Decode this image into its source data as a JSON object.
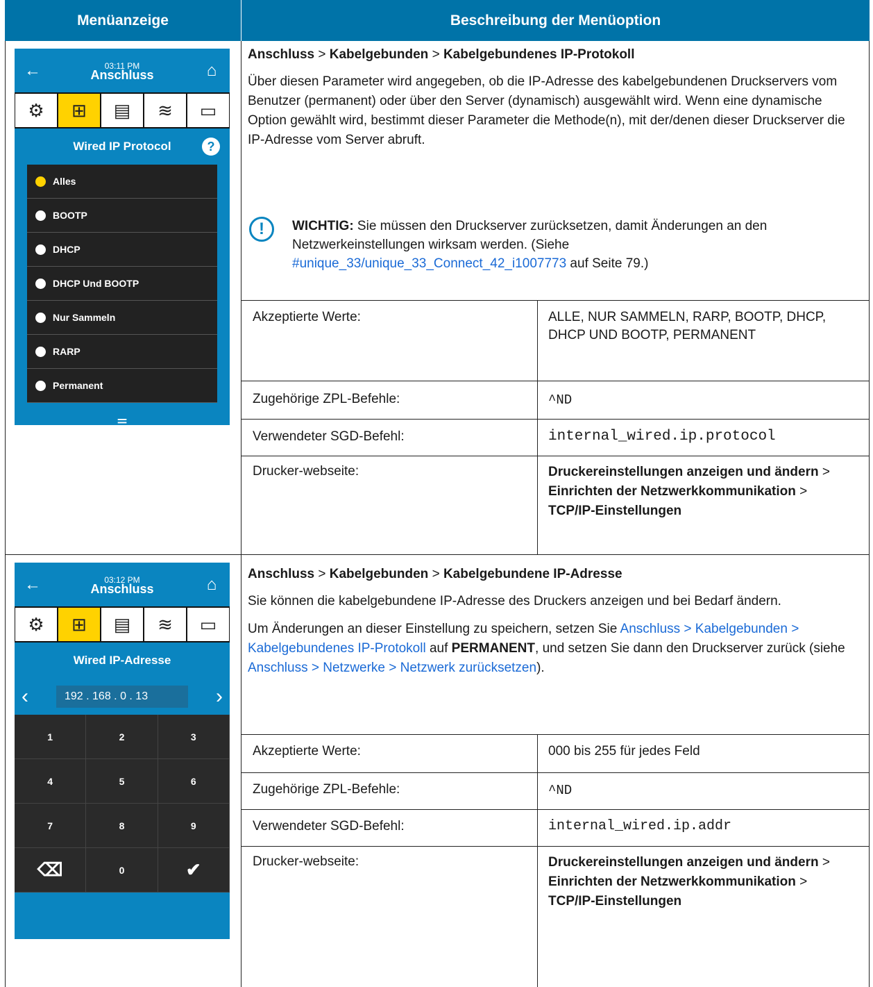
{
  "headers": {
    "col1": "Menüanzeige",
    "col2": "Beschreibung der Menüoption"
  },
  "row1": {
    "device": {
      "time": "03:11 PM",
      "title": "Anschluss",
      "subtitle": "Wired IP Protocol",
      "help_glyph": "?",
      "options": [
        "Alles",
        "BOOTP",
        "DHCP",
        "DHCP Und BOOTP",
        "Nur Sammeln",
        "RARP",
        "Permanent"
      ],
      "selected_index": 0
    },
    "path": [
      "Anschluss",
      "Kabelgebunden",
      "Kabelgebundenes IP-Protokoll"
    ],
    "sep": ">",
    "description": "Über diesen Parameter wird angegeben, ob die IP-Adresse des kabelgebundenen Druckservers vom Benutzer (permanent) oder über den Server (dynamisch) ausgewählt wird. Wenn eine dynamische Option gewählt wird, bestimmt dieser Parameter die Methode(n), mit der/denen dieser Druckserver die IP-Adresse vom Server abruft.",
    "note": {
      "label": "WICHTIG:",
      "text1": " Sie müssen den Druckserver zurücksetzen, damit Änderungen an den Netzwerkeinstellungen wirksam werden. (Siehe ",
      "link": "#unique_33/unique_33_Connect_42_i1007773",
      "text2": " auf Seite 79.)"
    },
    "accepted_label": "Akzeptierte Werte:",
    "accepted_value": "ALLE, NUR SAMMELN, RARP, BOOTP, DHCP, DHCP UND BOOTP, PERMANENT",
    "zpl_label": "Zugehörige ZPL-Befehle:",
    "zpl_value": "^ND",
    "sgd_label": "Verwendeter SGD-Befehl:",
    "sgd_value": "internal_wired.ip.protocol",
    "web_label": "Drucker-webseite:",
    "web_parts": [
      "Druckereinstellungen anzeigen und ändern",
      "Einrichten der Netzwerkkommunikation",
      "TCP/IP-Einstellungen"
    ]
  },
  "row2": {
    "device": {
      "time": "03:12 PM",
      "title": "Anschluss",
      "subtitle": "Wired IP-Adresse",
      "ip": "192 . 168 .  0  .  13",
      "keys": [
        "1",
        "2",
        "3",
        "4",
        "5",
        "6",
        "7",
        "8",
        "9",
        "⌫",
        "0",
        "✔"
      ]
    },
    "path": [
      "Anschluss",
      "Kabelgebunden",
      "Kabelgebundene IP-Adresse"
    ],
    "sep": ">",
    "description": "Sie können die kabelgebundene IP-Adresse des Druckers anzeigen und bei Bedarf ändern.",
    "save_text1": "Um Änderungen an dieser Einstellung zu speichern, setzen Sie ",
    "save_link1": "Anschluss > Kabelgebunden > Kabelgebundenes IP-Protokoll",
    "save_text2": " auf ",
    "save_bold": "PERMANENT",
    "save_text3": ", und setzen Sie dann den Druckserver zurück (siehe ",
    "save_link2": "Anschluss > Netzwerke > Netzwerk zurücksetzen",
    "save_text4": ").",
    "accepted_label": "Akzeptierte Werte:",
    "accepted_value": "000 bis 255 für jedes Feld",
    "zpl_label": "Zugehörige ZPL-Befehle:",
    "zpl_value": "^ND",
    "sgd_label": "Verwendeter SGD-Befehl:",
    "sgd_value": "internal_wired.ip.addr",
    "web_label": "Drucker-webseite:",
    "web_parts": [
      "Druckereinstellungen anzeigen und ändern",
      "Einrichten der Netzwerkkommunikation",
      "TCP/IP-Einstellungen"
    ]
  },
  "colors": {
    "header": "#0073a8",
    "device_blue": "#0a85c0",
    "selected": "#ffd200",
    "link": "#1a6ad6"
  }
}
